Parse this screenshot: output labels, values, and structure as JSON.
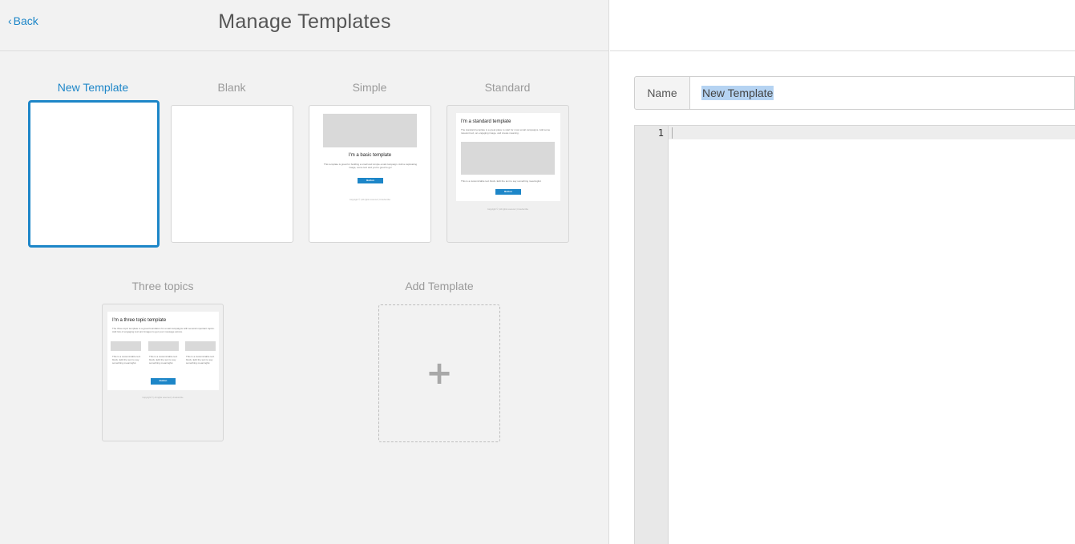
{
  "header": {
    "back_label": "Back",
    "title": "Manage Templates"
  },
  "templates": [
    {
      "label": "New Template",
      "state": "selected"
    },
    {
      "label": "Blank"
    },
    {
      "label": "Simple",
      "preview": {
        "heading": "I'm a basic template",
        "body": "This template is great for building a small and simple email campaign. Add a captivating image, some text and you're good to go!",
        "button": "Button",
        "footer": "Copyright © | All rights reserved | Unsubscribe"
      }
    },
    {
      "label": "Standard",
      "preview": {
        "heading": "I'm a standard template",
        "body": "The standard template is a great place to start for most email campaigns. Add some relevant text, an engaging image, and create meaning.",
        "caption": "This is a customizable text block. Edit the text to say something meaningful.",
        "button": "Button",
        "footer": "Copyright © | All rights reserved | Unsubscribe"
      }
    },
    {
      "label": "Three topics",
      "preview": {
        "heading": "I'm a three topic template",
        "body": "The three topic template is a great foundation for email campaigns with several important topics. Add lots of engaging text and images to get your message across.",
        "columns": [
          "This is a customizable text block. Edit the text to say something meaningful.",
          "This is a customizable text block. Edit the text to say something meaningful.",
          "This is a customizable text block. Edit the text to say something meaningful."
        ],
        "button": "Button",
        "footer": "Copyright © | All rights reserved | Unsubscribe"
      }
    },
    {
      "label": "Add Template",
      "icon": "plus-icon"
    }
  ],
  "editor": {
    "name_label": "Name",
    "name_value": "New Template",
    "line_number": "1"
  },
  "colors": {
    "accent": "#1d86c8",
    "panel_bg": "#f2f2f2",
    "selection": "#b5d3f2"
  }
}
